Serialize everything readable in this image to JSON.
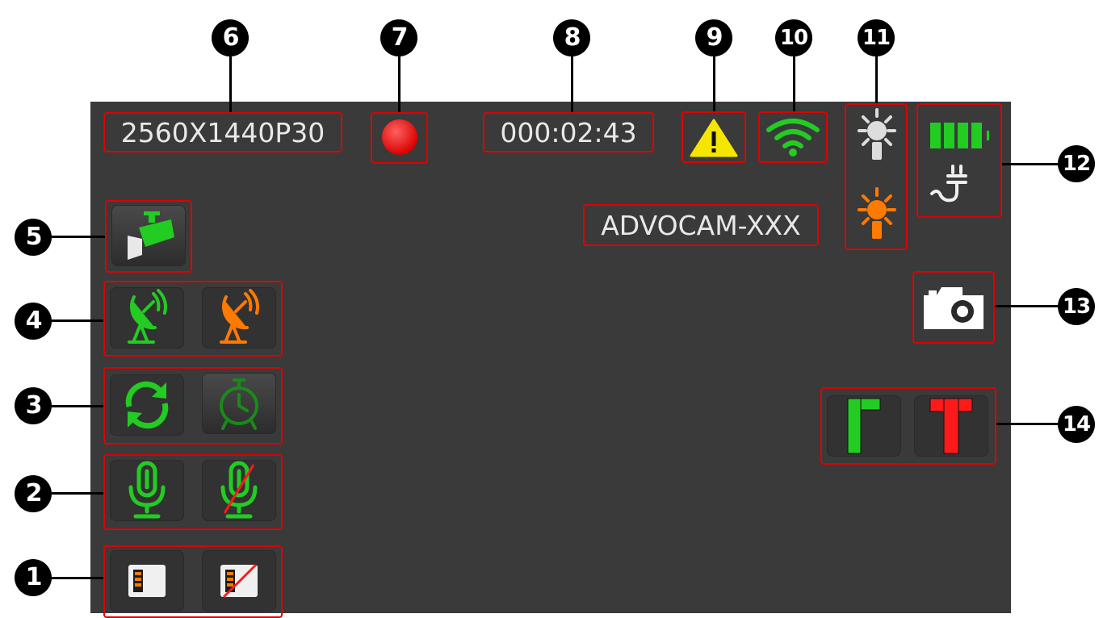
{
  "status_bar": {
    "resolution": "2560X1440P30",
    "elapsed_time": "000:02:43",
    "device_name": "ADVOCAM-XXX"
  },
  "callouts": [
    "1",
    "2",
    "3",
    "4",
    "5",
    "6",
    "7",
    "8",
    "9",
    "10",
    "11",
    "12",
    "13",
    "14"
  ],
  "colors": {
    "background": "#3a3a3a",
    "highlight": "#e00000",
    "green": "#22cc22",
    "orange": "#ff7a00",
    "red": "#ff1a1a",
    "warning_yellow": "#f5e600"
  },
  "icons": {
    "record": "record-dot-icon",
    "warning": "warning-triangle-icon",
    "wifi": "wifi-icon",
    "light_white": "white-light-bulb-icon",
    "light_orange": "orange-light-bulb-icon",
    "battery": "battery-full-icon",
    "power_plug": "power-plug-icon",
    "camera_mode": "security-camera-icon",
    "gps_green": "satellite-dish-green-icon",
    "gps_orange": "satellite-dish-orange-icon",
    "loop_record": "loop-refresh-icon",
    "timer": "stopwatch-icon",
    "mic_on": "microphone-icon",
    "mic_off": "microphone-muted-icon",
    "sd_card": "sd-card-icon",
    "sd_card_off": "sd-card-disabled-icon",
    "snapshot": "photo-camera-icon",
    "marker_green": "green-bracket-marker-icon",
    "marker_red": "red-t-marker-icon"
  }
}
